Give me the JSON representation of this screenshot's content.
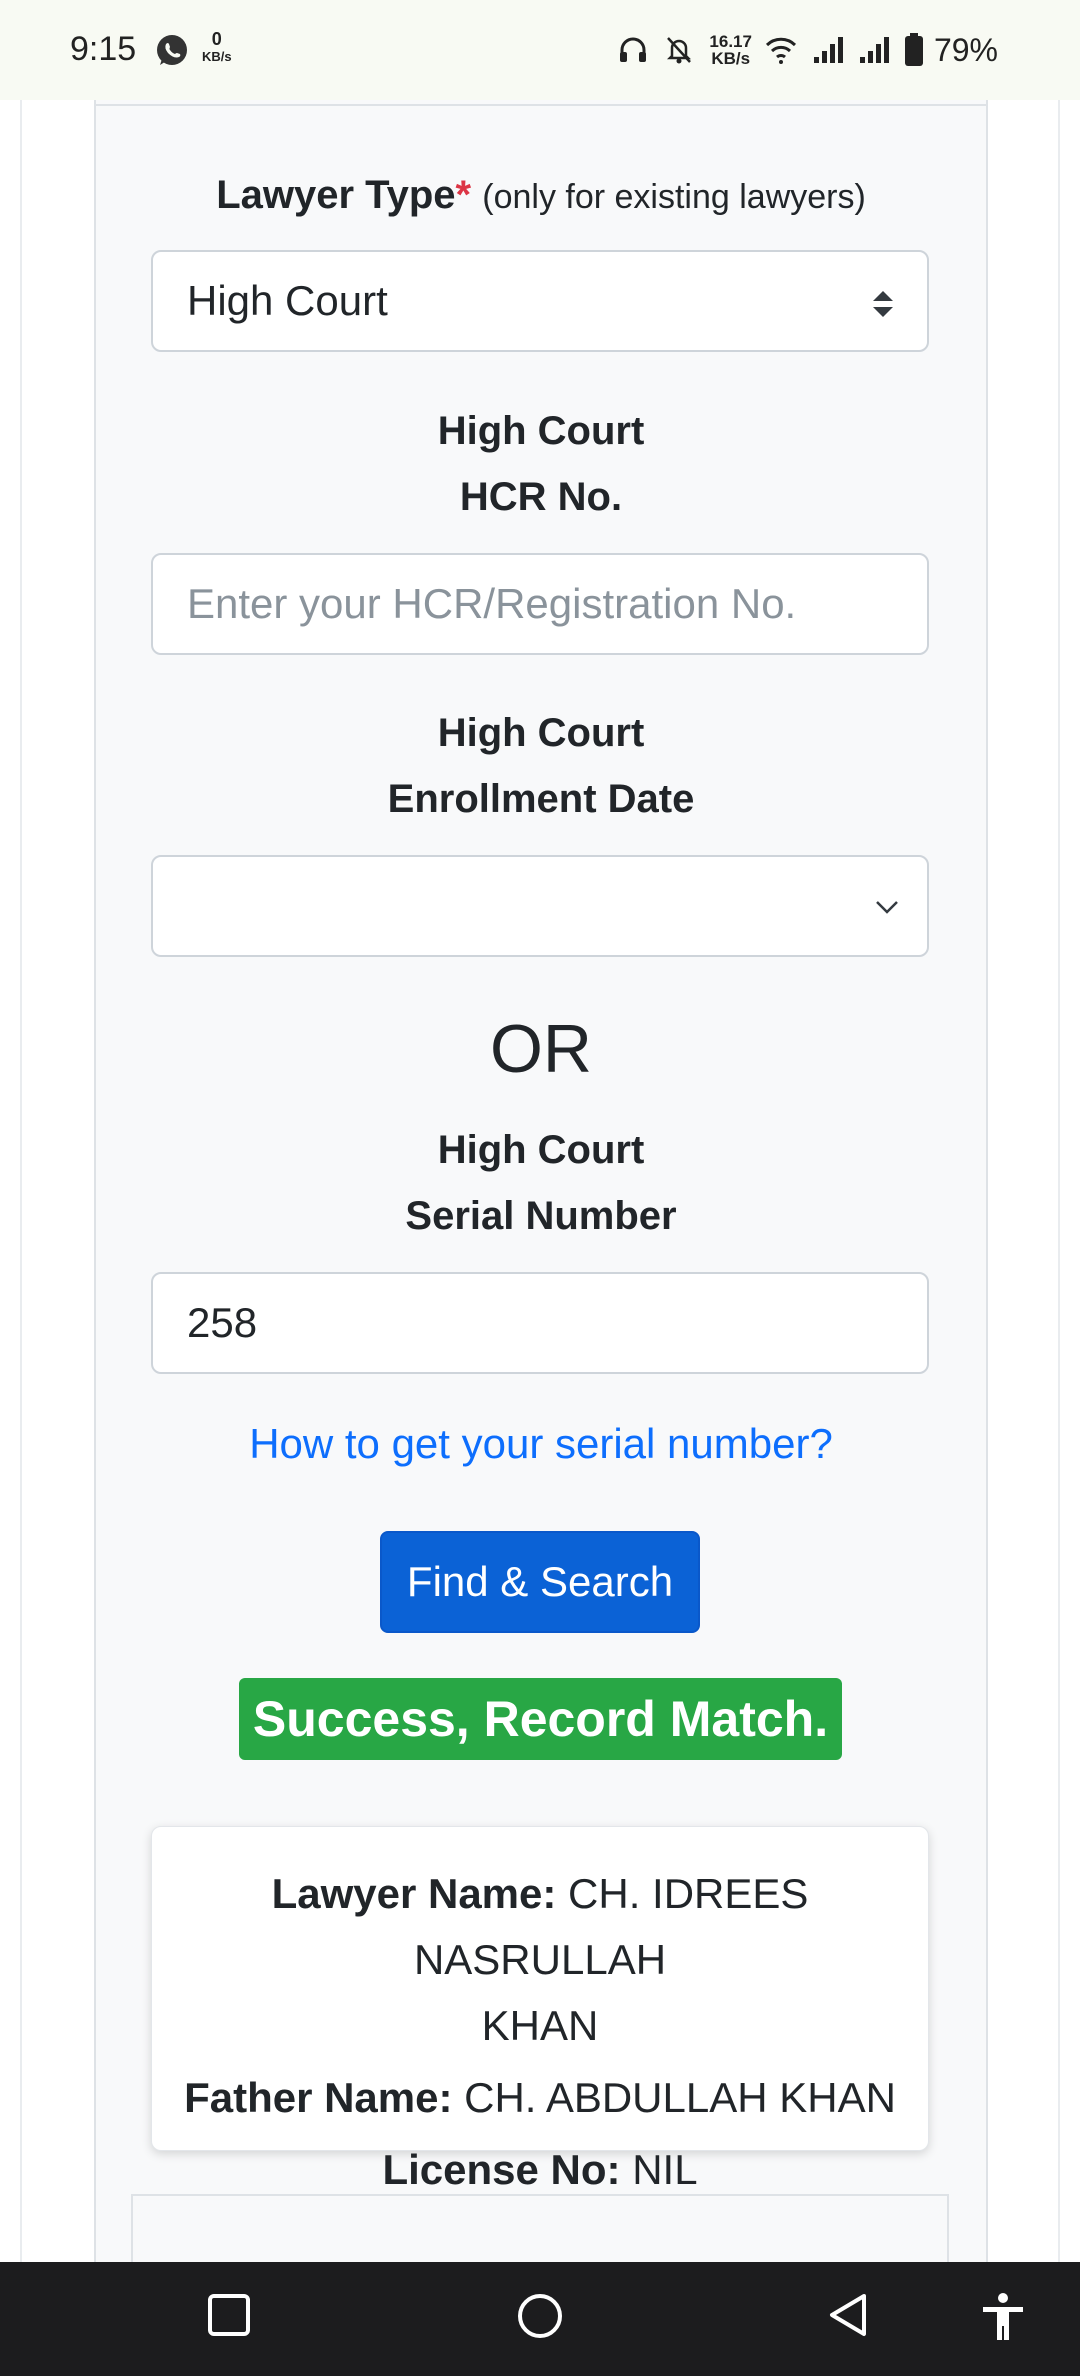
{
  "status_bar": {
    "time": "9:15",
    "net_speed_left_value": "0",
    "net_speed_left_unit": "KB/s",
    "net_speed_right_value": "16.17",
    "net_speed_right_unit": "KB/s",
    "battery": "79%"
  },
  "form": {
    "lawyer_type_label": "Lawyer Type",
    "required_mark": "*",
    "lawyer_type_hint": "(only for existing lawyers)",
    "lawyer_type_value": "High Court",
    "hcr_label_line1": "High Court",
    "hcr_label_line2": "HCR No.",
    "hcr_placeholder": "Enter your HCR/Registration No.",
    "enroll_label_line1": "High Court",
    "enroll_label_line2": "Enrollment Date",
    "enroll_value": "",
    "or_text": "OR",
    "serial_label_line1": "High Court",
    "serial_label_line2": "Serial Number",
    "serial_value": "258",
    "serial_help_link": "How to get your serial number?",
    "search_button": "Find & Search"
  },
  "result": {
    "status": "Success, Record Match.",
    "lawyer_name_label": "Lawyer Name:",
    "lawyer_name_line1": "CH. IDREES NASRULLAH",
    "lawyer_name_line2": "KHAN",
    "father_name_label": "Father Name:",
    "father_name": "CH. ABDULLAH KHAN",
    "license_label": "License No:",
    "license_no": "NIL"
  },
  "colors": {
    "primary": "#0b62d6",
    "success": "#28a745",
    "link": "#0d6efd",
    "required": "#dc3545"
  }
}
